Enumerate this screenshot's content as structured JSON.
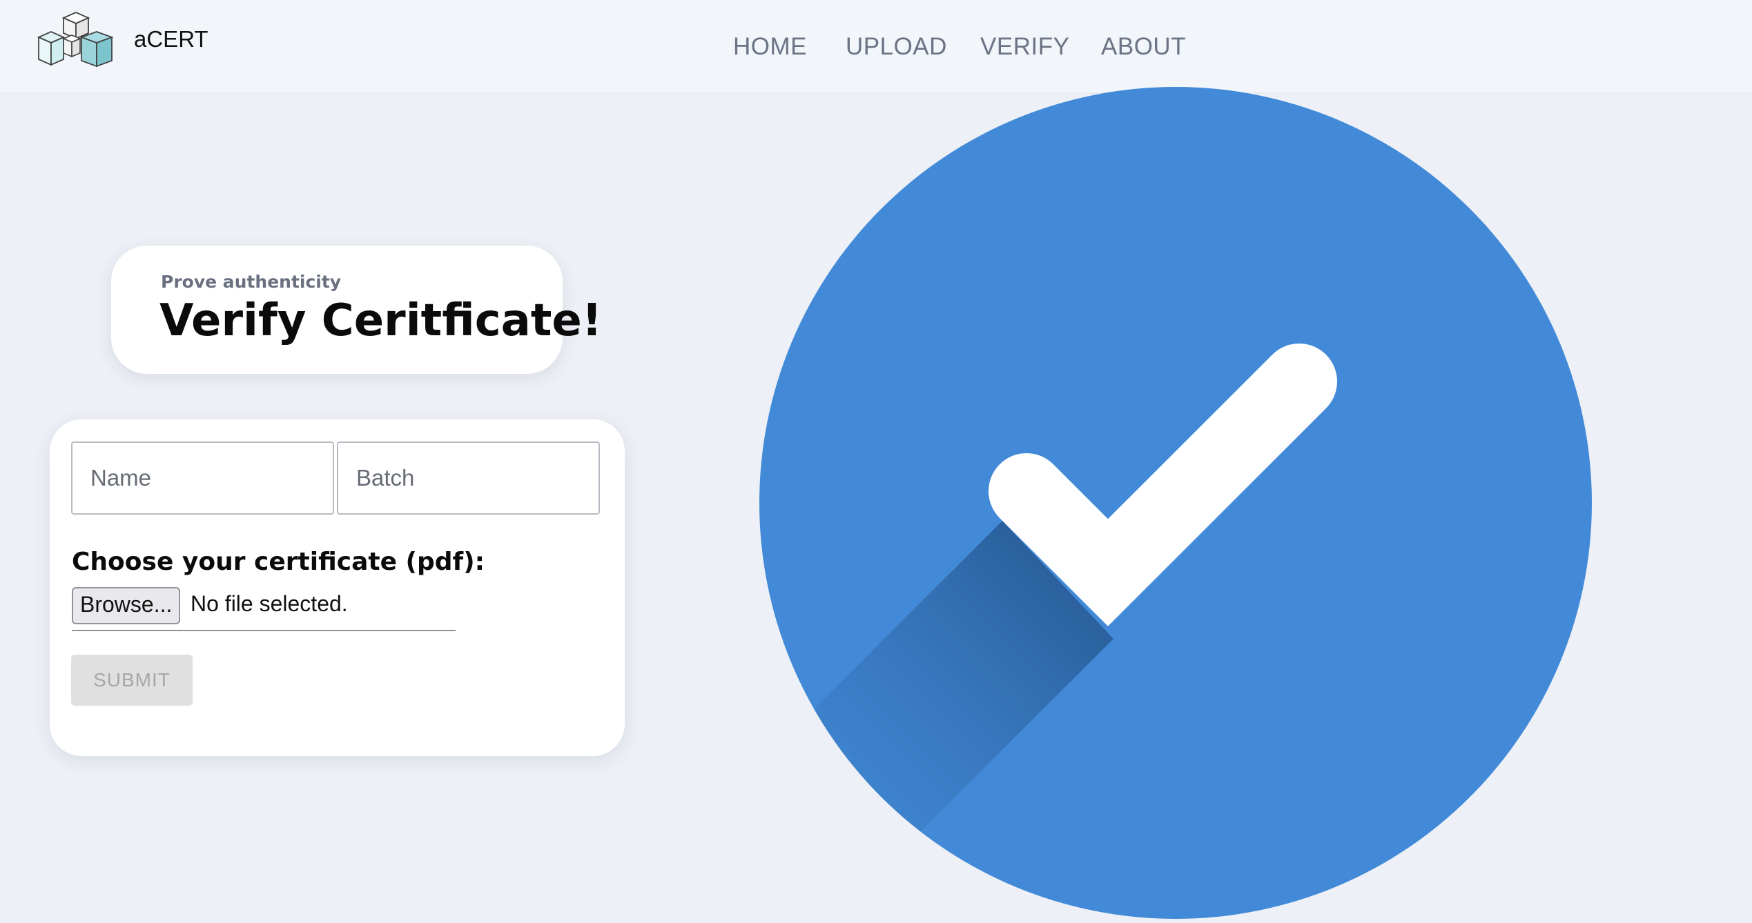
{
  "header": {
    "brand": "aCERT",
    "nav": [
      {
        "label": "HOME"
      },
      {
        "label": "UPLOAD"
      },
      {
        "label": "VERIFY"
      },
      {
        "label": "ABOUT"
      }
    ]
  },
  "hero_card": {
    "subtitle": "Prove authenticity",
    "title": "Verify Ceritficate!"
  },
  "form": {
    "name_placeholder": "Name",
    "batch_placeholder": "Batch",
    "file_label": "Choose your certificate (pdf):",
    "browse_label": "Browse...",
    "file_status": "No file selected.",
    "submit_label": "SUBMIT"
  },
  "colors": {
    "background": "#edf0f6",
    "header_background": "#f2f5fa",
    "nav_text": "#6b7385",
    "check_circle": "#428ad8",
    "checkmark": "#ffffff",
    "submit_disabled": "#e0e0e0"
  },
  "icons": {
    "logo": "stacked-cubes-icon",
    "hero": "check-circle-icon"
  }
}
